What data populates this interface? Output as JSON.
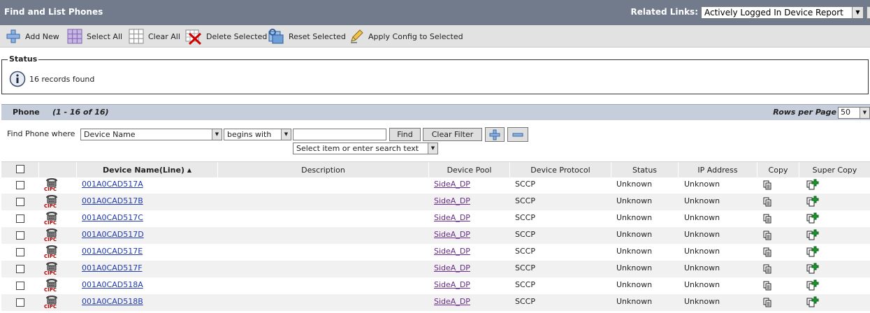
{
  "header": {
    "title": "Find and List Phones",
    "related_links_label": "Related Links:",
    "related_links_value": "Actively Logged In Device Report"
  },
  "toolbar": {
    "add_new": "Add New",
    "select_all": "Select All",
    "clear_all": "Clear All",
    "delete_selected": "Delete Selected",
    "reset_selected": "Reset Selected",
    "apply_config": "Apply Config to Selected"
  },
  "status": {
    "legend": "Status",
    "message": "16 records found"
  },
  "phone_section": {
    "title": "Phone",
    "range": "(1 - 16 of 16)",
    "rows_per_page_label": "Rows per Page",
    "rows_per_page_value": "50"
  },
  "search": {
    "label": "Find Phone where",
    "field": "Device Name",
    "operator": "begins with",
    "value": "",
    "find_button": "Find",
    "clear_filter_button": "Clear Filter",
    "add_button": "+",
    "remove_button": "−",
    "secondary_select": "Select item or enter search text"
  },
  "table": {
    "columns": {
      "device_name": "Device Name(Line)",
      "description": "Description",
      "device_pool": "Device Pool",
      "device_protocol": "Device Protocol",
      "status": "Status",
      "ip_address": "IP Address",
      "copy": "Copy",
      "super_copy": "Super Copy"
    },
    "device_type_label": "CIPC",
    "rows": [
      {
        "name": "001A0CAD517A",
        "description": "",
        "pool": "SideA_DP",
        "protocol": "SCCP",
        "status": "Unknown",
        "ip": "Unknown"
      },
      {
        "name": "001A0CAD517B",
        "description": "",
        "pool": "SideA_DP",
        "protocol": "SCCP",
        "status": "Unknown",
        "ip": "Unknown"
      },
      {
        "name": "001A0CAD517C",
        "description": "",
        "pool": "SideA_DP",
        "protocol": "SCCP",
        "status": "Unknown",
        "ip": "Unknown"
      },
      {
        "name": "001A0CAD517D",
        "description": "",
        "pool": "SideA_DP",
        "protocol": "SCCP",
        "status": "Unknown",
        "ip": "Unknown"
      },
      {
        "name": "001A0CAD517E",
        "description": "",
        "pool": "SideA_DP",
        "protocol": "SCCP",
        "status": "Unknown",
        "ip": "Unknown"
      },
      {
        "name": "001A0CAD517F",
        "description": "",
        "pool": "SideA_DP",
        "protocol": "SCCP",
        "status": "Unknown",
        "ip": "Unknown"
      },
      {
        "name": "001A0CAD518A",
        "description": "",
        "pool": "SideA_DP",
        "protocol": "SCCP",
        "status": "Unknown",
        "ip": "Unknown"
      },
      {
        "name": "001A0CAD518B",
        "description": "",
        "pool": "SideA_DP",
        "protocol": "SCCP",
        "status": "Unknown",
        "ip": "Unknown"
      }
    ]
  },
  "colors": {
    "title_bar": "#727b8c",
    "link": "#1f3bb3",
    "visited_link": "#6a2b8a",
    "cipc_red": "#b00000"
  }
}
